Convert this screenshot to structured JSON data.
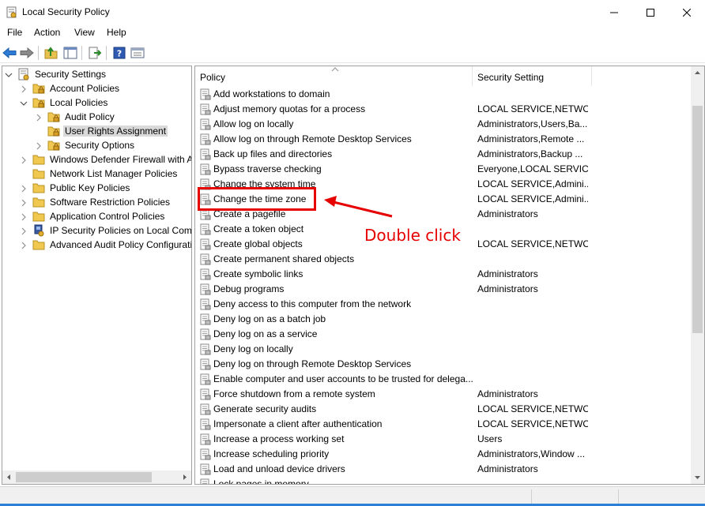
{
  "window": {
    "title": "Local Security Policy",
    "icon": "security-policy-icon"
  },
  "menu": [
    "File",
    "Action",
    "View",
    "Help"
  ],
  "toolbar": {
    "icons": [
      "back-arrow-icon",
      "forward-arrow-icon",
      "up-folder-icon",
      "show-hide-tree-icon",
      "export-list-icon",
      "help-icon",
      "console-view-icon"
    ]
  },
  "tree": {
    "items": [
      {
        "label": "Security Settings",
        "depth": 0,
        "expander": "expanded",
        "icon": "security-settings-icon"
      },
      {
        "label": "Account Policies",
        "depth": 1,
        "expander": "collapsed",
        "icon": "folder-lock-icon"
      },
      {
        "label": "Local Policies",
        "depth": 1,
        "expander": "expanded",
        "icon": "folder-lock-icon"
      },
      {
        "label": "Audit Policy",
        "depth": 2,
        "expander": "collapsed",
        "icon": "folder-lock-icon"
      },
      {
        "label": "User Rights Assignment",
        "depth": 2,
        "expander": "none",
        "icon": "folder-lock-icon",
        "selected": true
      },
      {
        "label": "Security Options",
        "depth": 2,
        "expander": "collapsed",
        "icon": "folder-lock-icon"
      },
      {
        "label": "Windows Defender Firewall with Adva",
        "depth": 1,
        "expander": "collapsed",
        "icon": "folder-icon"
      },
      {
        "label": "Network List Manager Policies",
        "depth": 1,
        "expander": "none",
        "icon": "folder-icon"
      },
      {
        "label": "Public Key Policies",
        "depth": 1,
        "expander": "collapsed",
        "icon": "folder-icon"
      },
      {
        "label": "Software Restriction Policies",
        "depth": 1,
        "expander": "collapsed",
        "icon": "folder-icon"
      },
      {
        "label": "Application Control Policies",
        "depth": 1,
        "expander": "collapsed",
        "icon": "folder-icon"
      },
      {
        "label": "IP Security Policies on Local Compute",
        "depth": 1,
        "expander": "collapsed",
        "icon": "ip-security-icon"
      },
      {
        "label": "Advanced Audit Policy Configuration",
        "depth": 1,
        "expander": "collapsed",
        "icon": "folder-icon"
      }
    ]
  },
  "list": {
    "columns": [
      "Policy",
      "Security Setting"
    ],
    "rows": [
      {
        "policy": "Add workstations to domain",
        "setting": ""
      },
      {
        "policy": "Adjust memory quotas for a process",
        "setting": "LOCAL SERVICE,NETWO..."
      },
      {
        "policy": "Allow log on locally",
        "setting": "Administrators,Users,Ba..."
      },
      {
        "policy": "Allow log on through Remote Desktop Services",
        "setting": "Administrators,Remote ..."
      },
      {
        "policy": "Back up files and directories",
        "setting": "Administrators,Backup ..."
      },
      {
        "policy": "Bypass traverse checking",
        "setting": "Everyone,LOCAL SERVIC..."
      },
      {
        "policy": "Change the system time",
        "setting": "LOCAL SERVICE,Admini..."
      },
      {
        "policy": "Change the time zone",
        "setting": "LOCAL SERVICE,Admini..."
      },
      {
        "policy": "Create a pagefile",
        "setting": "Administrators"
      },
      {
        "policy": "Create a token object",
        "setting": ""
      },
      {
        "policy": "Create global objects",
        "setting": "LOCAL SERVICE,NETWO..."
      },
      {
        "policy": "Create permanent shared objects",
        "setting": ""
      },
      {
        "policy": "Create symbolic links",
        "setting": "Administrators"
      },
      {
        "policy": "Debug programs",
        "setting": "Administrators"
      },
      {
        "policy": "Deny access to this computer from the network",
        "setting": ""
      },
      {
        "policy": "Deny log on as a batch job",
        "setting": ""
      },
      {
        "policy": "Deny log on as a service",
        "setting": ""
      },
      {
        "policy": "Deny log on locally",
        "setting": ""
      },
      {
        "policy": "Deny log on through Remote Desktop Services",
        "setting": ""
      },
      {
        "policy": "Enable computer and user accounts to be trusted for delega...",
        "setting": ""
      },
      {
        "policy": "Force shutdown from a remote system",
        "setting": "Administrators"
      },
      {
        "policy": "Generate security audits",
        "setting": "LOCAL SERVICE,NETWO..."
      },
      {
        "policy": "Impersonate a client after authentication",
        "setting": "LOCAL SERVICE,NETWO..."
      },
      {
        "policy": "Increase a process working set",
        "setting": "Users"
      },
      {
        "policy": "Increase scheduling priority",
        "setting": "Administrators,Window ..."
      },
      {
        "policy": "Load and unload device drivers",
        "setting": "Administrators"
      },
      {
        "policy": "Lock pages in memory",
        "setting": ""
      }
    ]
  },
  "annotation": {
    "text": "Double click",
    "color": "#e60000"
  },
  "colors": {
    "selection": "#d9d9d9",
    "accent": "#2b7fd6"
  }
}
